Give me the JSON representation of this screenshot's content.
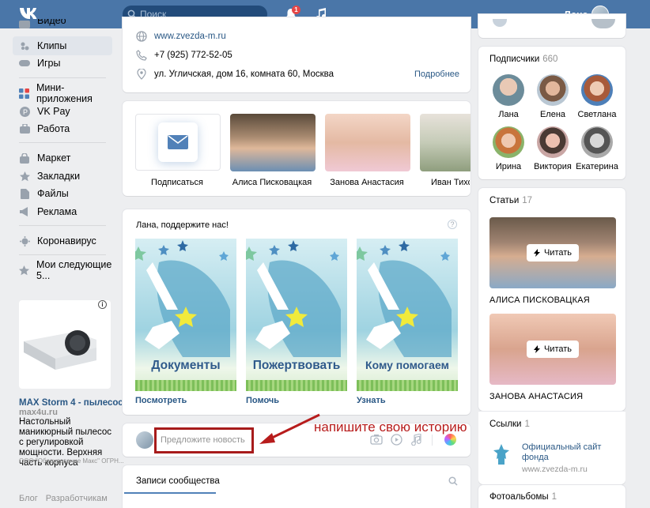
{
  "header": {
    "search_placeholder": "Поиск",
    "notification_count": "1",
    "username": "Лана"
  },
  "sidebar": {
    "items": [
      {
        "label": "Видео"
      },
      {
        "label": "Клипы"
      },
      {
        "label": "Игры"
      },
      {
        "label": "Мини-приложения"
      },
      {
        "label": "VK Pay"
      },
      {
        "label": "Работа"
      },
      {
        "label": "Маркет"
      },
      {
        "label": "Закладки"
      },
      {
        "label": "Файлы"
      },
      {
        "label": "Реклама"
      },
      {
        "label": "Коронавирус"
      },
      {
        "label": "Мои следующие 5..."
      }
    ],
    "ad": {
      "title": "MAX Storm 4 - пылесос...",
      "domain": "max4u.ru",
      "text": "Настольный маникюрный пылесос с регулировкой мощности. Верхняя часть корпуса",
      "legal": "ООО \"Оборудование Макс\" ОГРН..."
    },
    "footer": [
      "Блог",
      "Разработчикам"
    ]
  },
  "contacts": {
    "website": "www.zvezda-m.ru",
    "phone": "+7 (925) 772-52-05",
    "address": "ул. Угличская, дом 16, комната 60, Москва",
    "more_link": "Подробнее"
  },
  "tiles": [
    {
      "label": "Подписаться"
    },
    {
      "label": "Алиса Писковацкая"
    },
    {
      "label": "Занова Анастасия"
    },
    {
      "label": "Иван Тихо"
    }
  ],
  "support": {
    "title": "Лана, поддержите нас!",
    "help_mark": "?",
    "banners": [
      {
        "word": "Документы",
        "link": "Посмотреть"
      },
      {
        "word": "Пожертвовать",
        "link": "Помочь"
      },
      {
        "word": "Кому помогаем",
        "link": "Узнать"
      }
    ]
  },
  "composer": {
    "placeholder": "Предложите новость",
    "annotation": "напишите свою историю"
  },
  "wall": {
    "tab_label": "Записи сообщества"
  },
  "subscribers": {
    "title": "Подписчики",
    "count": "660",
    "people": [
      {
        "name": "Лана"
      },
      {
        "name": "Елена"
      },
      {
        "name": "Светлана"
      },
      {
        "name": "Ирина"
      },
      {
        "name": "Виктория"
      },
      {
        "name": "Екатерина"
      }
    ]
  },
  "articles": {
    "title": "Статьи",
    "count": "17",
    "read_label": "Читать",
    "items": [
      {
        "caption": "АЛИСА ПИСКОВАЦКАЯ"
      },
      {
        "caption": "ЗАНОВА АНАСТАСИЯ"
      }
    ]
  },
  "links": {
    "title": "Ссылки",
    "count": "1",
    "item_title": "Официальный сайт фонда",
    "item_url": "www.zvezda-m.ru"
  },
  "albums": {
    "title": "Фотоальбомы",
    "count": "1"
  }
}
